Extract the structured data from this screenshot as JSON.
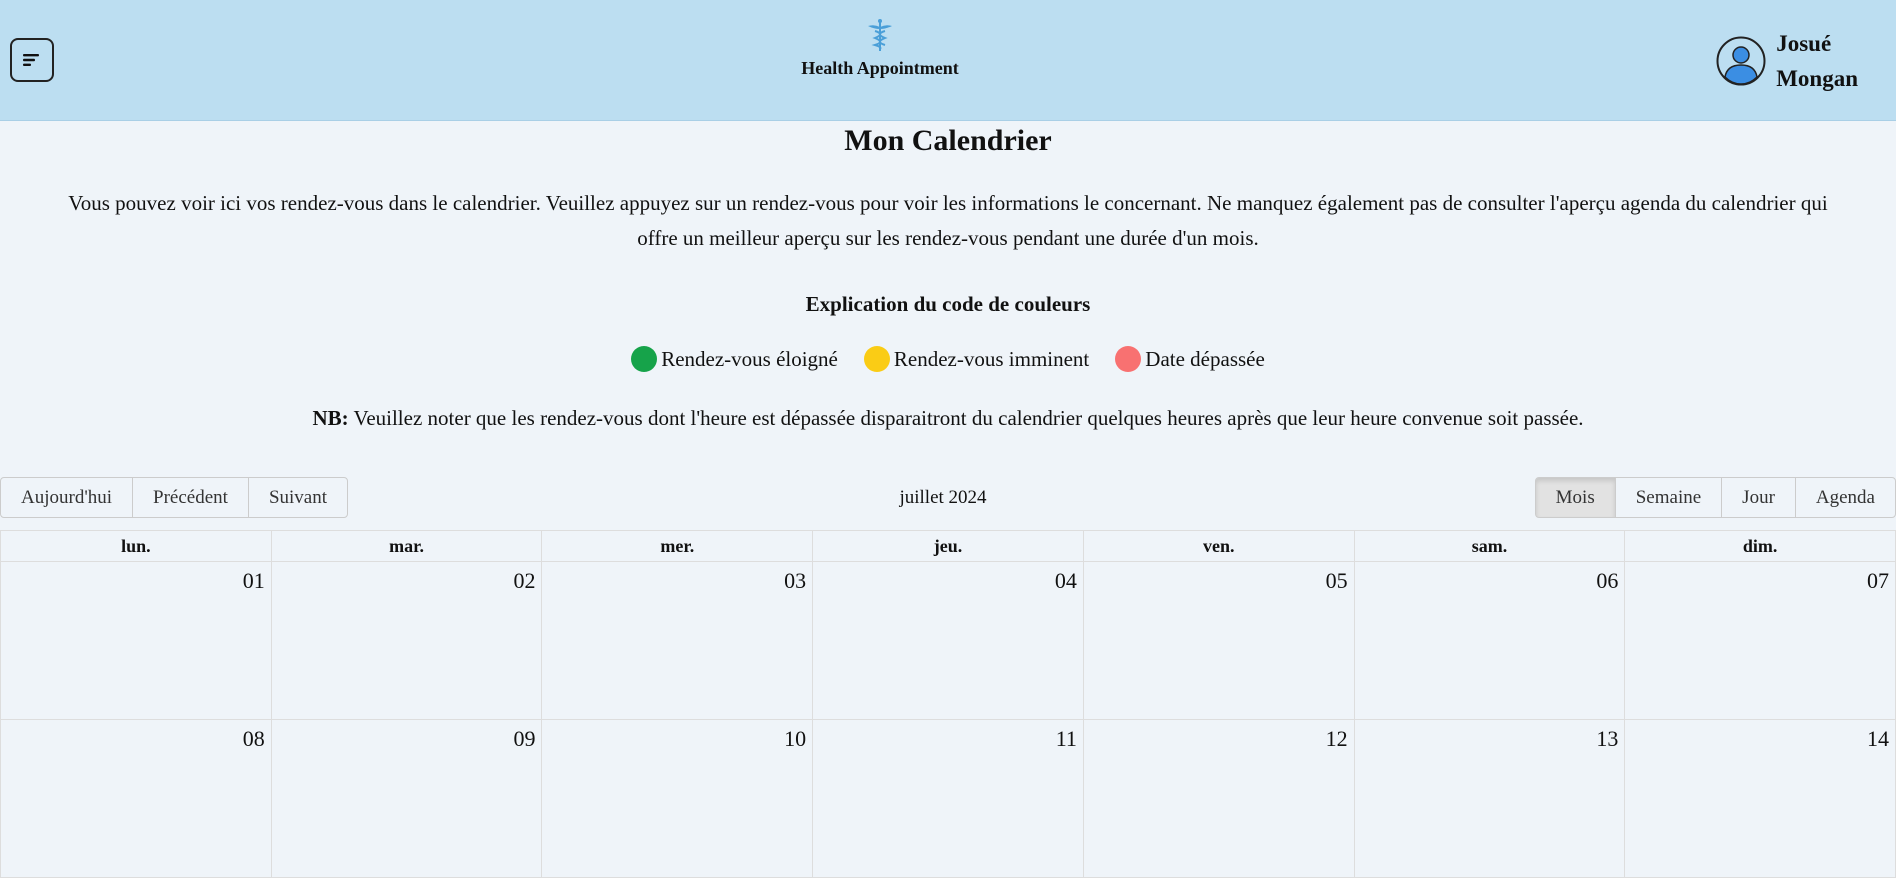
{
  "header": {
    "brand_title": "Health Appointment",
    "user_first": "Josué",
    "user_last": "Mongan"
  },
  "page": {
    "title": "Mon Calendrier",
    "intro": "Vous pouvez voir ici vos rendez-vous dans le calendrier. Veuillez appuyez sur un rendez-vous pour voir les informations le concernant. Ne manquez également pas de consulter l'aperçu agenda du calendrier qui offre un meilleur aperçu sur les rendez-vous pendant une durée d'un mois.",
    "legend_title": "Explication du code de couleurs",
    "legend": [
      {
        "label": "Rendez-vous éloigné",
        "color": "#16a34a"
      },
      {
        "label": "Rendez-vous imminent",
        "color": "#facc15"
      },
      {
        "label": "Date dépassée",
        "color": "#f87171"
      }
    ],
    "nb_label": "NB:",
    "nb_text": " Veuillez noter que les rendez-vous dont l'heure est dépassée disparaitront du calendrier quelques heures après que leur heure convenue soit passée."
  },
  "toolbar": {
    "today": "Aujourd'hui",
    "prev": "Précédent",
    "next": "Suivant",
    "label": "juillet 2024",
    "views": [
      "Mois",
      "Semaine",
      "Jour",
      "Agenda"
    ],
    "active_view": "Mois"
  },
  "calendar": {
    "weekdays": [
      "lun.",
      "mar.",
      "mer.",
      "jeu.",
      "ven.",
      "sam.",
      "dim."
    ],
    "weeks": [
      [
        "01",
        "02",
        "03",
        "04",
        "05",
        "06",
        "07"
      ],
      [
        "08",
        "09",
        "10",
        "11",
        "12",
        "13",
        "14"
      ]
    ]
  },
  "colors": {
    "header_bg": "#bcdef1",
    "page_bg": "#eff4f9"
  }
}
